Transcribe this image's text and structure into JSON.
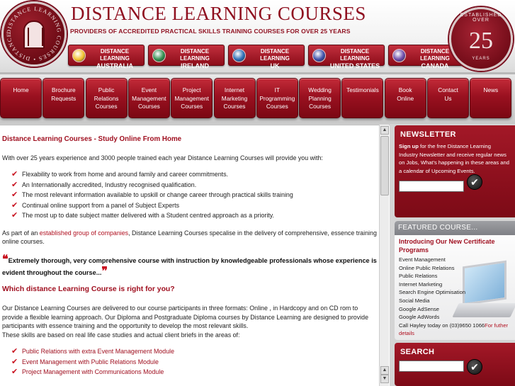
{
  "header": {
    "title": "DISTANCE LEARNING COURSES",
    "tagline": "PROVIDERS OF ACCREDITED PRACTICAL SKILLS TRAINING COURSES FOR OVER 25 YEARS",
    "seal_text": "DISTANCE LEARNING COURSES",
    "badge": {
      "top": "ESTABLISHED OVER",
      "number": "25",
      "bottom": "YEARS"
    },
    "countries": [
      {
        "line1": "DISTANCE LEARNING",
        "line2": "AUSTRALIA",
        "flag_color": "#f2c12e"
      },
      {
        "line1": "DISTANCE LEARNING",
        "line2": "IRELAND",
        "flag_color": "#2f8f4e"
      },
      {
        "line1": "DISTANCE LEARNING",
        "line2": "UK",
        "flag_color": "#2a6db5"
      },
      {
        "line1": "DISTANCE LEARNING",
        "line2": "UNITED STATES",
        "flag_color": "#3b4fa8"
      },
      {
        "line1": "DISTANCE LEARNING",
        "line2": "CANADA",
        "flag_color": "#6b4aa8"
      }
    ]
  },
  "nav": [
    {
      "lines": [
        "Home"
      ]
    },
    {
      "lines": [
        "Brochure",
        "Requests"
      ]
    },
    {
      "lines": [
        "Public",
        "Relations",
        "Courses"
      ]
    },
    {
      "lines": [
        "Event",
        "Management",
        "Courses"
      ]
    },
    {
      "lines": [
        "Project",
        "Management",
        "Courses"
      ]
    },
    {
      "lines": [
        "Internet",
        "Marketing",
        "Courses"
      ]
    },
    {
      "lines": [
        "IT",
        "Programming",
        "Courses"
      ]
    },
    {
      "lines": [
        "Wedding",
        "Planning",
        "Courses"
      ]
    },
    {
      "lines": [
        "Testimonials"
      ]
    },
    {
      "lines": [
        "Book",
        "Online"
      ]
    },
    {
      "lines": [
        "Contact",
        "Us"
      ]
    },
    {
      "lines": [
        "News"
      ]
    }
  ],
  "main": {
    "heading": "Distance Learning Courses - Study Online From Home",
    "intro": "With over 25 years experience and 3000 people trained each year Distance Learning Courses will provide you with:",
    "benefits": [
      "Flexability to work from home and around family and career commitments.",
      "An Internationally accredited, Industry recognised qualification.",
      "The most relevant information available to upskill or change career through practical skills training",
      "Continual online support from a panel of Subject Experts",
      "The most up to date subject matter delivered with a Student centred approach as a priority."
    ],
    "group_pre": "As part of an ",
    "group_link": "established group of companies",
    "group_post": ", Distance Learning Courses specalise in the delivery of comprehensive, essence training online courses.",
    "quote": "Extremely thorough, very comprehensive course with instruction by knowledgeable professionals whose experience is evident throughout the course...",
    "question": "Which distance Learning Course is right for you?",
    "delivery": "Our Distance Learning Courses are delivered to our course participants in three formats: Online , in Hardcopy and on CD rom to provide a flexible learning approach. Our Diploma and Postgraduate Diploma courses by Distance Learning are designed to provide participants with essence training and the opportunity to develop the most relevant skills.",
    "skills_intro": "These skills are based on real life case studies and actual client briefs in the areas of:",
    "course_links": [
      "Public Relations with extra Event Management Module",
      "Event Management with Public Relations Module",
      "Project Management with Communications Module"
    ]
  },
  "sidebar": {
    "newsletter": {
      "title": "NEWSLETTER",
      "signup_bold": "Sign up",
      "text": " for the free Distance Learning Industry Newsletter and receive regular news on Jobs, What's happening in these areas and a calendar of Upcoming Events."
    },
    "featured": {
      "title": "FEATURED COURSE...",
      "subtitle": "Introducing Our New Certificate Programs",
      "items": [
        "Event Management",
        "Online Public Relations",
        "Public Relations",
        "Internet Marketing",
        "Search Engine Optimisation",
        "Social Media",
        "Google AdSense",
        "Google AdWords"
      ],
      "call": "Call Hayley today on (03)9650 1066",
      "more": "For futher details"
    },
    "search": {
      "title": "SEARCH"
    }
  },
  "colors": {
    "brand_red": "#8f0f1f",
    "link_red": "#b01020",
    "tick_red": "#c8101f"
  }
}
